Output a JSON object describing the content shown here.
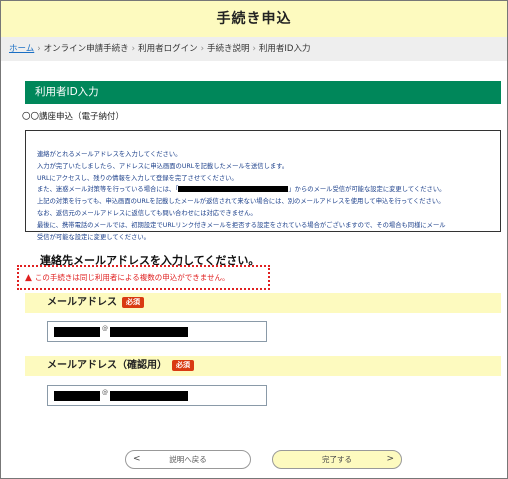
{
  "header": {
    "title": "手続き申込"
  },
  "breadcrumb": {
    "items": [
      "ホーム",
      "オンライン申請手続き",
      "利用者ログイン",
      "手続き説明",
      "利用者ID入力"
    ],
    "separator": "›"
  },
  "section": {
    "title": "利用者ID入力"
  },
  "course": {
    "name": "〇〇講座申込（電子納付）"
  },
  "notice": {
    "line1": "連絡がとれるメールアドレスを入力してください。",
    "line2": "入力が完了いたしましたら、アドレスに申込画面のURLを記載したメールを送信します。",
    "line3": "URLにアクセスし、残りの情報を入力して登録を完了させてください。",
    "line4a": "また、迷惑メール対策等を行っている場合には、「",
    "line4b": "」からのメール受信が可能な設定に変更してください。",
    "line5": "上記の対策を行っても、申込画面のURLを記載したメールが返信されて来ない場合には、別のメールアドレスを使用して申込を行ってください。",
    "line6": "なお、返信元のメールアドレスに返信しても問い合わせには対応できません。",
    "line7": "最後に、携帯電話のメールでは、初期設定でURLリンク付きメールを拒否する設定をされている場合がございますので、その場合も同様にメール",
    "line8": "受信が可能な設定に変更してください。"
  },
  "form": {
    "heading": "連絡先メールアドレスを入力してください。",
    "warning": "この手続きは同じ利用者による複数の申込ができません。",
    "email_label": "メールアドレス",
    "email_confirm_label": "メールアドレス（確認用）",
    "required_badge": "必須",
    "email_at": "@"
  },
  "buttons": {
    "back": "説明へ戻る",
    "done": "完了する"
  },
  "colors": {
    "header_bg": "#fdfabf",
    "section_green": "#00875a",
    "notice_text": "#1b3f8a",
    "warning_red": "#e02020",
    "required_badge": "#d93a12",
    "link_blue": "#1a6fc4"
  },
  "icons": {
    "warning": "warning-triangle-icon",
    "back": "chevron-left-icon",
    "done": "chevron-right-icon"
  }
}
